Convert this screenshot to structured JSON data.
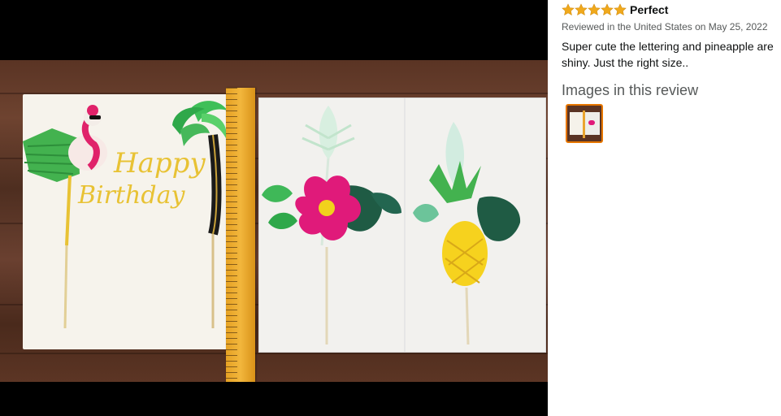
{
  "review": {
    "rating": 5,
    "rating_max": 5,
    "title": "Perfect",
    "meta": "Reviewed in the United States on May 25, 2022",
    "body": "Super cute the lettering and pineapple are shiny. Just the right size..",
    "images_heading": "Images in this review",
    "thumbnail_count": 1
  },
  "photo": {
    "topper_text_line1": "Happy",
    "topper_text_line2": "Birthday"
  },
  "colors": {
    "star": "#f0a91c",
    "thumb_border": "#e77600",
    "glitter_gold": "#e8c234",
    "hibiscus": "#e01a7a",
    "leaf_dark": "#1f5b44",
    "leaf_green": "#3cb371"
  },
  "icons": [
    "star-icon"
  ]
}
